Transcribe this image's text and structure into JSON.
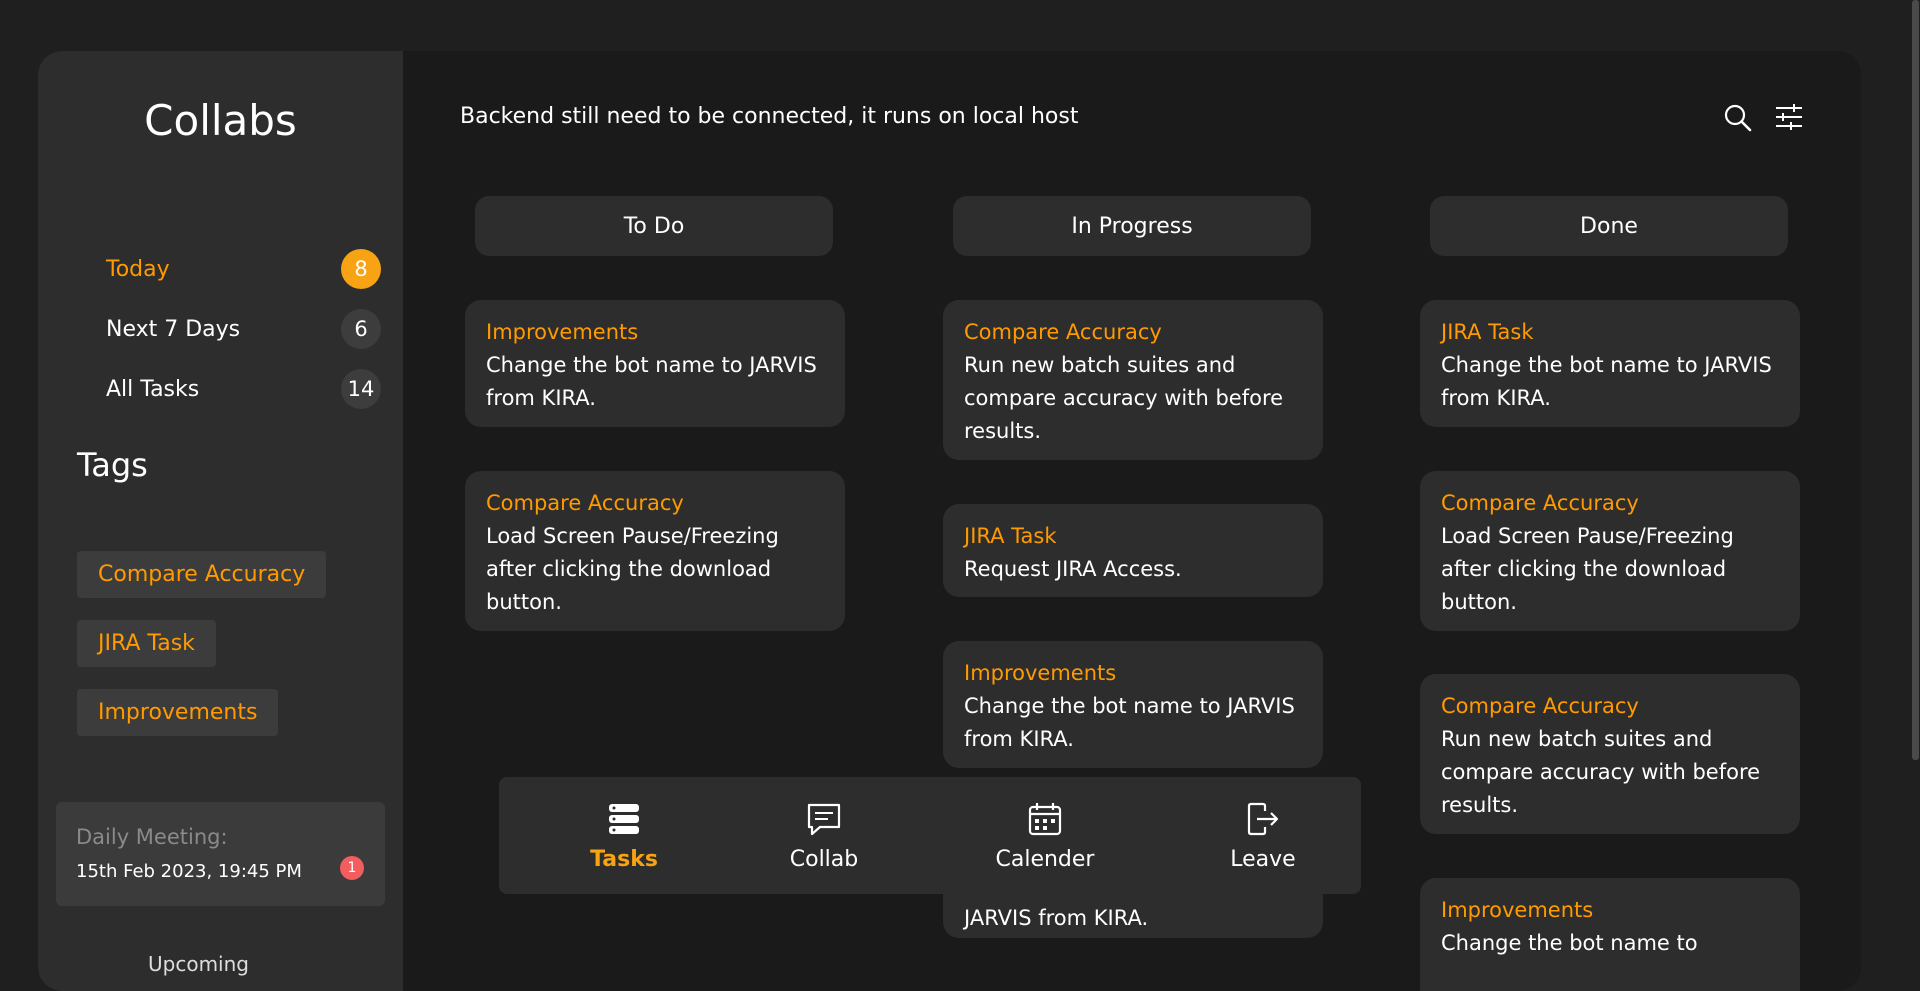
{
  "sidebar": {
    "brand": "Collabs",
    "nav": [
      {
        "label": "Today",
        "count": "8"
      },
      {
        "label": "Next 7 Days",
        "count": "6"
      },
      {
        "label": "All Tasks",
        "count": "14"
      }
    ],
    "tags_title": "Tags",
    "tags": [
      "Compare Accuracy",
      "JIRA Task",
      "Improvements"
    ],
    "meeting": {
      "label": "Daily Meeting:",
      "time": "15th Feb 2023, 19:45 PM",
      "badge": "1"
    },
    "cut_text": "Upcoming"
  },
  "header": {
    "notice": "Backend still need to be connected, it runs on local host",
    "icons": [
      "search-icon",
      "filter-sliders-icon"
    ]
  },
  "columns": [
    {
      "title": "To Do",
      "cards": [
        {
          "tag": "Improvements",
          "text": "Change the bot name to JARVIS from KIRA."
        },
        {
          "tag": "Compare Accuracy",
          "text": "Load Screen Pause/Freezing after clicking the download button."
        }
      ]
    },
    {
      "title": "In Progress",
      "cards": [
        {
          "tag": "Compare Accuracy",
          "text": "Run new batch suites and compare accuracy with before results."
        },
        {
          "tag": "JIRA Task",
          "text": "Request JIRA Access."
        },
        {
          "tag": "Improvements",
          "text": "Change the bot name to JARVIS from KIRA."
        },
        {
          "tag": "",
          "text": "JARVIS from KIRA."
        }
      ]
    },
    {
      "title": "Done",
      "cards": [
        {
          "tag": "JIRA Task",
          "text": "Change the bot name to JARVIS from KIRA."
        },
        {
          "tag": "Compare Accuracy",
          "text": "Load Screen Pause/Freezing after clicking the download button."
        },
        {
          "tag": "Compare Accuracy",
          "text": "Run new batch suites and compare accuracy with before results."
        },
        {
          "tag": "Improvements",
          "text": "Change the bot name to"
        }
      ]
    }
  ],
  "bottom_nav": [
    {
      "label": "Tasks",
      "icon": "tasks-stack-icon",
      "active": true
    },
    {
      "label": "Collab",
      "icon": "chat-icon",
      "active": false
    },
    {
      "label": "Calender",
      "icon": "calendar-icon",
      "active": false
    },
    {
      "label": "Leave",
      "icon": "logout-icon",
      "active": false
    }
  ],
  "colors": {
    "accent": "#f7a313",
    "tag_text": "#ff9b00",
    "panel": "#2d2d2d",
    "background": "#1a1a1a",
    "badge_red": "#f25d5d"
  }
}
